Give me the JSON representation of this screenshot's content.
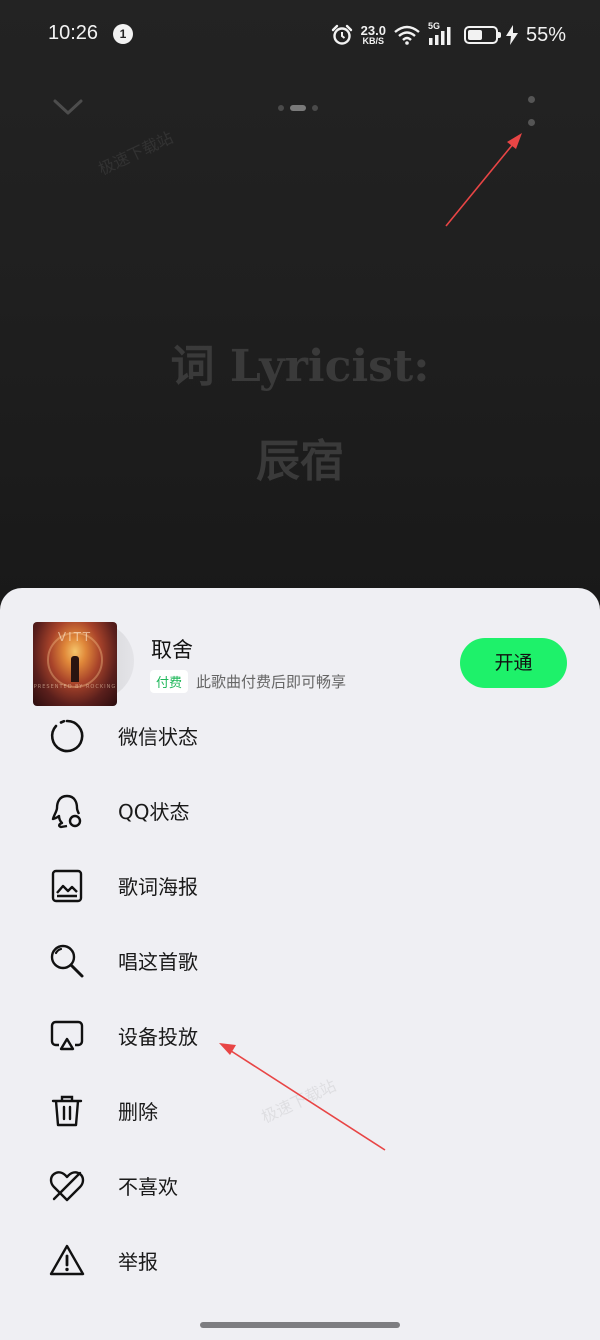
{
  "status_bar": {
    "time": "10:26",
    "notification_count": "1",
    "net_speed_value": "23.0",
    "net_speed_unit": "KB/S",
    "network_type": "5G",
    "battery_percent": "55%",
    "battery_level": 0.55
  },
  "player": {
    "lyric_line_1": "词 Lyricist:",
    "lyric_line_2": "辰宿",
    "watermark": "极速下载站",
    "page_count": 3,
    "active_page": 2
  },
  "sheet": {
    "song": {
      "title": "取舍",
      "paid_badge": "付费",
      "paid_desc": "此歌曲付费后即可畅享",
      "cover_text": "VITT",
      "cover_caption": "PRESENTED BY ROCKING"
    },
    "open_button": "开通",
    "open_button_color": "#1EF16A",
    "menu": [
      {
        "label": "微信状态",
        "icon": "wechat-status-icon"
      },
      {
        "label": "QQ状态",
        "icon": "qq-status-icon"
      },
      {
        "label": "歌词海报",
        "icon": "lyrics-poster-icon"
      },
      {
        "label": "唱这首歌",
        "icon": "microphone-icon"
      },
      {
        "label": "设备投放",
        "icon": "cast-icon"
      },
      {
        "label": "删除",
        "icon": "trash-icon"
      },
      {
        "label": "不喜欢",
        "icon": "dislike-heart-icon"
      },
      {
        "label": "举报",
        "icon": "warning-icon"
      }
    ]
  },
  "annotation_color": "#E84545"
}
